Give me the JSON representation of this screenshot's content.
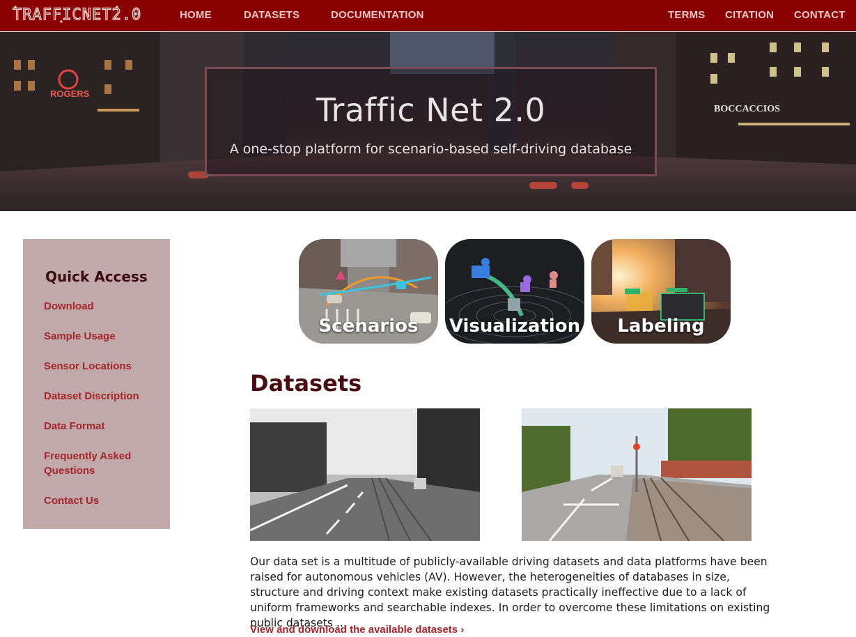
{
  "brand": {
    "logo_text": "TRAFFICNET2.0"
  },
  "nav": {
    "left": [
      {
        "label": "HOME"
      },
      {
        "label": "DATASETS"
      },
      {
        "label": "DOCUMENTATION"
      }
    ],
    "right": [
      {
        "label": "TERMS"
      },
      {
        "label": "CITATION"
      },
      {
        "label": "CONTACT"
      }
    ]
  },
  "hero": {
    "title": "Traffic Net 2.0",
    "subtitle": "A one-stop platform for scenario-based self-driving database",
    "signs": [
      "ROGERS",
      "BOCCACCIOS"
    ]
  },
  "sidebar": {
    "title": "Quick Access",
    "items": [
      {
        "label": "Download"
      },
      {
        "label": "Sample Usage"
      },
      {
        "label": "Sensor Locations"
      },
      {
        "label": "Dataset Discription"
      },
      {
        "label": "Data Format"
      },
      {
        "label": "Frequently Asked Questions"
      },
      {
        "label": "Contact Us"
      }
    ]
  },
  "tiles": [
    {
      "label": "Scenarios"
    },
    {
      "label": "Visualization"
    },
    {
      "label": "Labeling"
    }
  ],
  "datasets": {
    "title": "Datasets",
    "description": "Our data set is a multitude of publicly-available driving datasets and data platforms have been raised for autonomous vehicles (AV). However, the heterogeneities of databases in size, structure and driving context make existing datasets practically ineffective due to a lack of uniform frameworks and searchable indexes. In order to overcome these limitations on existing public datasets ...",
    "link": "View and download the available datasets ›"
  },
  "colors": {
    "nav_bg": "#8b0000",
    "sidebar_bg": "#c1a9a9",
    "accent_link": "#a3262c",
    "heading": "#4a0d12"
  }
}
